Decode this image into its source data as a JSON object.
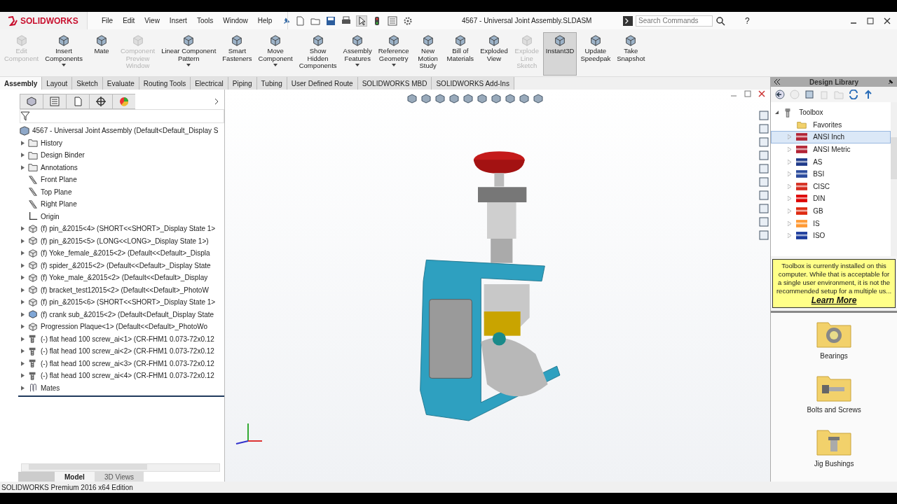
{
  "app": {
    "logo": "SOLIDWORKS",
    "menu": [
      "File",
      "Edit",
      "View",
      "Insert",
      "Tools",
      "Window",
      "Help"
    ],
    "document_title": "4567 - Universal Joint Assembly.SLDASM",
    "search": {
      "placeholder": "Search Commands"
    },
    "help": "?"
  },
  "ribbon": [
    {
      "label": "Edit\nComponent",
      "disabled": true,
      "selected": false,
      "dropdown": false
    },
    {
      "label": "Insert\nComponents",
      "disabled": false,
      "selected": false,
      "dropdown": true
    },
    {
      "label": "Mate",
      "disabled": false,
      "selected": false,
      "dropdown": false
    },
    {
      "label": "Component\nPreview\nWindow",
      "disabled": true,
      "selected": false,
      "dropdown": false
    },
    {
      "label": "Linear Component\nPattern",
      "disabled": false,
      "selected": false,
      "dropdown": true
    },
    {
      "label": "Smart\nFasteners",
      "disabled": false,
      "selected": false,
      "dropdown": false
    },
    {
      "label": "Move\nComponent",
      "disabled": false,
      "selected": false,
      "dropdown": true
    },
    {
      "label": "Show\nHidden\nComponents",
      "disabled": false,
      "selected": false,
      "dropdown": false
    },
    {
      "label": "Assembly\nFeatures",
      "disabled": false,
      "selected": false,
      "dropdown": true
    },
    {
      "label": "Reference\nGeometry",
      "disabled": false,
      "selected": false,
      "dropdown": true
    },
    {
      "label": "New\nMotion\nStudy",
      "disabled": false,
      "selected": false,
      "dropdown": false
    },
    {
      "label": "Bill of\nMaterials",
      "disabled": false,
      "selected": false,
      "dropdown": false
    },
    {
      "label": "Exploded\nView",
      "disabled": false,
      "selected": false,
      "dropdown": false
    },
    {
      "label": "Explode\nLine\nSketch",
      "disabled": true,
      "selected": false,
      "dropdown": false
    },
    {
      "label": "Instant3D",
      "disabled": false,
      "selected": true,
      "dropdown": false
    },
    {
      "label": "Update\nSpeedpak",
      "disabled": false,
      "selected": false,
      "dropdown": false
    },
    {
      "label": "Take\nSnapshot",
      "disabled": false,
      "selected": false,
      "dropdown": false
    }
  ],
  "tabs": [
    {
      "label": "Assembly",
      "selected": true
    },
    {
      "label": "Layout",
      "selected": false
    },
    {
      "label": "Sketch",
      "selected": false
    },
    {
      "label": "Evaluate",
      "selected": false
    },
    {
      "label": "Routing Tools",
      "selected": false
    },
    {
      "label": "Electrical",
      "selected": false
    },
    {
      "label": "Piping",
      "selected": false
    },
    {
      "label": "Tubing",
      "selected": false
    },
    {
      "label": "User Defined Route",
      "selected": false
    },
    {
      "label": "SOLIDWORKS MBD",
      "selected": false
    },
    {
      "label": "SOLIDWORKS Add-Ins",
      "selected": false
    }
  ],
  "feature_tree": {
    "root": "4567 - Universal Joint Assembly  (Default<Default_Display S",
    "items": [
      {
        "label": "History",
        "kind": "folder",
        "expandable": true
      },
      {
        "label": "Design Binder",
        "kind": "folder",
        "expandable": true
      },
      {
        "label": "Annotations",
        "kind": "folder",
        "expandable": true
      },
      {
        "label": "Front Plane",
        "kind": "plane",
        "expandable": false
      },
      {
        "label": "Top Plane",
        "kind": "plane",
        "expandable": false
      },
      {
        "label": "Right Plane",
        "kind": "plane",
        "expandable": false
      },
      {
        "label": "Origin",
        "kind": "origin",
        "expandable": false
      },
      {
        "label": "(f) pin_&2015<4> (SHORT<<SHORT>_Display State 1>",
        "kind": "part",
        "expandable": true
      },
      {
        "label": "(f) pin_&2015<5> (LONG<<LONG>_Display State 1>)",
        "kind": "part",
        "expandable": true
      },
      {
        "label": "(f) Yoke_female_&2015<2> (Default<<Default>_Displa",
        "kind": "part",
        "expandable": true
      },
      {
        "label": "(f) spider_&2015<2> (Default<<Default>_Display State",
        "kind": "part",
        "expandable": true
      },
      {
        "label": "(f) Yoke_male_&2015<2> (Default<<Default>_Display",
        "kind": "part",
        "expandable": true
      },
      {
        "label": "(f) bracket_test12015<2> (Default<<Default>_PhotoW",
        "kind": "part",
        "expandable": true
      },
      {
        "label": "(f) pin_&2015<6> (SHORT<<SHORT>_Display State 1>",
        "kind": "part",
        "expandable": true
      },
      {
        "label": "(f) crank sub_&2015<2> (Default<Default_Display State",
        "kind": "subassembly",
        "expandable": true
      },
      {
        "label": "Progression Plaque<1> (Default<<Default>_PhotoWo",
        "kind": "part",
        "expandable": true
      },
      {
        "label": "(-) flat head 100 screw_ai<1> (CR-FHM1 0.073-72x0.12",
        "kind": "screw",
        "expandable": true
      },
      {
        "label": "(-) flat head 100 screw_ai<2> (CR-FHM1 0.073-72x0.12",
        "kind": "screw",
        "expandable": true
      },
      {
        "label": "(-) flat head 100 screw_ai<3> (CR-FHM1 0.073-72x0.12",
        "kind": "screw",
        "expandable": true
      },
      {
        "label": "(-) flat head 100 screw_ai<4> (CR-FHM1 0.073-72x0.12",
        "kind": "screw",
        "expandable": true
      },
      {
        "label": "Mates",
        "kind": "mates",
        "expandable": true
      }
    ]
  },
  "bottom_tabs": [
    {
      "label": "Model",
      "selected": true
    },
    {
      "label": "3D Views",
      "selected": false
    }
  ],
  "status_bar": "SOLIDWORKS Premium 2016 x64 Edition",
  "design_library": {
    "title": "Design Library",
    "root": "Toolbox",
    "items": [
      {
        "label": "Favorites",
        "kind": "folder",
        "expandable": false,
        "selected": false
      },
      {
        "label": "ANSI Inch",
        "kind": "flag",
        "color": "#b22234",
        "expandable": true,
        "selected": true
      },
      {
        "label": "ANSI Metric",
        "kind": "flag",
        "color": "#b22234",
        "expandable": true,
        "selected": false
      },
      {
        "label": "AS",
        "kind": "flag",
        "color": "#1e3a8a",
        "expandable": true,
        "selected": false
      },
      {
        "label": "BSI",
        "kind": "flag",
        "color": "#2a4a9c",
        "expandable": true,
        "selected": false
      },
      {
        "label": "CISC",
        "kind": "flag",
        "color": "#d52b1e",
        "expandable": true,
        "selected": false
      },
      {
        "label": "DIN",
        "kind": "flag",
        "color": "#dd0000",
        "expandable": true,
        "selected": false
      },
      {
        "label": "GB",
        "kind": "flag",
        "color": "#de2910",
        "expandable": true,
        "selected": false
      },
      {
        "label": "IS",
        "kind": "flag",
        "color": "#ff9933",
        "expandable": true,
        "selected": false
      },
      {
        "label": "ISO",
        "kind": "flag",
        "color": "#1a3a9c",
        "expandable": true,
        "selected": false
      }
    ],
    "notice": "Toolbox is currently installed on this computer. While that is acceptable for a single user environment, it is not the recommended setup for a multiple us...",
    "notice_link": "Learn More",
    "folders": [
      {
        "label": "Bearings",
        "kind": "bearing"
      },
      {
        "label": "Bolts and Screws",
        "kind": "bolt"
      },
      {
        "label": "Jig Bushings",
        "kind": "bushing"
      }
    ]
  }
}
